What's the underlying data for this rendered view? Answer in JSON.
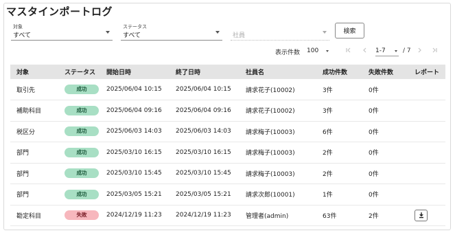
{
  "title": "マスタインポートログ",
  "filters": {
    "target": {
      "label": "対象",
      "value": "すべて"
    },
    "status": {
      "label": "ステータス",
      "value": "すべて"
    },
    "employee": {
      "placeholder": "社員"
    },
    "search_label": "検索"
  },
  "pager": {
    "rows_label": "表示件数",
    "rows_value": "100",
    "page_value": "1-7",
    "total": "/ 7"
  },
  "table": {
    "headers": [
      "対象",
      "ステータス",
      "開始日時",
      "終了日時",
      "社員名",
      "成功件数",
      "失敗件数",
      "レポート"
    ],
    "rows": [
      {
        "target": "取引先",
        "status": "成功",
        "status_type": "ok",
        "start": "2025/06/04 10:15",
        "end": "2025/06/04 10:15",
        "employee": "請求花子(10002)",
        "success": "3件",
        "fail": "0件",
        "report": false
      },
      {
        "target": "補助科目",
        "status": "成功",
        "status_type": "ok",
        "start": "2025/06/04 09:16",
        "end": "2025/06/04 09:16",
        "employee": "請求花子(10002)",
        "success": "3件",
        "fail": "0件",
        "report": false
      },
      {
        "target": "税区分",
        "status": "成功",
        "status_type": "ok",
        "start": "2025/06/03 14:03",
        "end": "2025/06/03 14:03",
        "employee": "請求梅子(10003)",
        "success": "6件",
        "fail": "0件",
        "report": false
      },
      {
        "target": "部門",
        "status": "成功",
        "status_type": "ok",
        "start": "2025/03/10 16:15",
        "end": "2025/03/10 16:15",
        "employee": "請求梅子(10003)",
        "success": "2件",
        "fail": "0件",
        "report": false
      },
      {
        "target": "部門",
        "status": "成功",
        "status_type": "ok",
        "start": "2025/03/10 15:45",
        "end": "2025/03/10 15:45",
        "employee": "請求梅子(10003)",
        "success": "2件",
        "fail": "0件",
        "report": false
      },
      {
        "target": "部門",
        "status": "成功",
        "status_type": "ok",
        "start": "2025/03/05 15:21",
        "end": "2025/03/05 15:21",
        "employee": "請求次郎(10001)",
        "success": "1件",
        "fail": "0件",
        "report": false
      },
      {
        "target": "勘定科目",
        "status": "失敗",
        "status_type": "ng",
        "start": "2024/12/19 11:23",
        "end": "2024/12/19 11:23",
        "employee": "管理者(admin)",
        "success": "63件",
        "fail": "2件",
        "report": true
      }
    ]
  },
  "icons": {
    "first_page": "first-page-icon",
    "prev_page": "prev-page-icon",
    "next_page": "next-page-icon",
    "last_page": "last-page-icon",
    "download": "download-icon"
  },
  "colors": {
    "success_badge": "#a8dfc4",
    "fail_badge": "#f7b7bd",
    "header_bg": "#e4e4e4"
  }
}
